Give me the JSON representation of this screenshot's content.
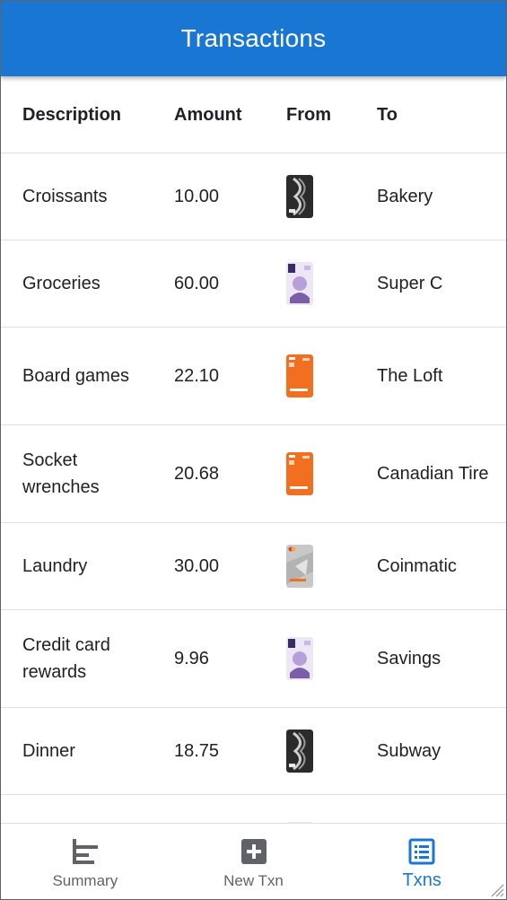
{
  "header": {
    "title": "Transactions"
  },
  "table": {
    "columns": {
      "description": "Description",
      "amount": "Amount",
      "from": "From",
      "to": "To"
    },
    "rows": [
      {
        "description": "Croissants",
        "amount": "10.00",
        "from_card": "black-card",
        "to": "Bakery"
      },
      {
        "description": "Groceries",
        "amount": "60.00",
        "from_card": "purple-card",
        "to": "Super C"
      },
      {
        "description": "Board games",
        "amount": "22.10",
        "from_card": "orange-card",
        "to": "The Loft"
      },
      {
        "description": "Socket wrenches",
        "amount": "20.68",
        "from_card": "orange-card",
        "to": "Canadian Tire"
      },
      {
        "description": "Laundry",
        "amount": "30.00",
        "from_card": "gray-card",
        "to": "Coinmatic"
      },
      {
        "description": "Credit card rewards",
        "amount": "9.96",
        "from_card": "purple-card",
        "to": "Savings"
      },
      {
        "description": "Dinner",
        "amount": "18.75",
        "from_card": "black-card",
        "to": "Subway"
      },
      {
        "description": "",
        "amount": "",
        "from_card": "purple-card",
        "to": ""
      }
    ]
  },
  "nav": {
    "items": [
      {
        "label": "Summary",
        "icon": "summary-icon"
      },
      {
        "label": "New Txn",
        "icon": "add-box-icon"
      },
      {
        "label": "Txns",
        "icon": "list-icon"
      }
    ],
    "active": "Txns"
  },
  "colors": {
    "primary": "#1976d2",
    "orange_card": "#f26f21",
    "purple_card": "#7b5ea7"
  }
}
